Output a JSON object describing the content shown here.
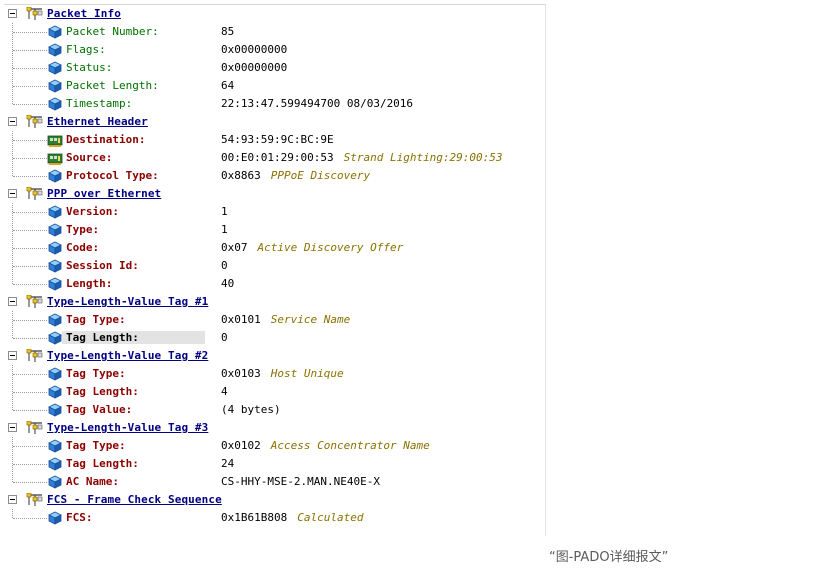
{
  "tree": {
    "sections": [
      {
        "title": "Packet Info",
        "fields": [
          {
            "name": "Packet Number:",
            "value": "85",
            "desc": "",
            "style": "plain",
            "icon": "cube-icon"
          },
          {
            "name": "Flags:",
            "value": "0x00000000",
            "desc": "",
            "style": "plain",
            "icon": "cube-icon"
          },
          {
            "name": "Status:",
            "value": "0x00000000",
            "desc": "",
            "style": "plain",
            "icon": "cube-icon"
          },
          {
            "name": "Packet Length:",
            "value": "64",
            "desc": "",
            "style": "plain",
            "icon": "cube-icon"
          },
          {
            "name": "Timestamp:",
            "value": "22:13:47.599494700 08/03/2016",
            "desc": "",
            "style": "plain",
            "icon": "cube-icon"
          }
        ]
      },
      {
        "title": "Ethernet Header",
        "fields": [
          {
            "name": "Destination:",
            "value": "54:93:59:9C:BC:9E",
            "desc": "",
            "style": "bold",
            "icon": "network-card-icon"
          },
          {
            "name": "Source:",
            "value": "00:E0:01:29:00:53",
            "desc": "Strand Lighting:29:00:53",
            "style": "bold",
            "icon": "network-card-icon"
          },
          {
            "name": "Protocol Type:",
            "value": "0x8863",
            "desc": "PPPoE Discovery",
            "style": "bold",
            "icon": "cube-icon"
          }
        ]
      },
      {
        "title": "PPP over Ethernet",
        "fields": [
          {
            "name": "Version:",
            "value": "1",
            "desc": "",
            "style": "bold",
            "icon": "cube-icon"
          },
          {
            "name": "Type:",
            "value": "1",
            "desc": "",
            "style": "bold",
            "icon": "cube-icon"
          },
          {
            "name": "Code:",
            "value": "0x07",
            "desc": "Active Discovery Offer",
            "style": "bold",
            "icon": "cube-icon"
          },
          {
            "name": "Session Id:",
            "value": "0",
            "desc": "",
            "style": "bold",
            "icon": "cube-icon"
          },
          {
            "name": "Length:",
            "value": "40",
            "desc": "",
            "style": "bold",
            "icon": "cube-icon"
          }
        ]
      },
      {
        "title": "Type-Length-Value Tag #1",
        "fields": [
          {
            "name": "Tag Type:",
            "value": "0x0101",
            "desc": "Service Name",
            "style": "bold",
            "icon": "cube-icon"
          },
          {
            "name": "Tag Length:",
            "value": "0",
            "desc": "",
            "style": "selected",
            "icon": "cube-icon"
          }
        ]
      },
      {
        "title": "Type-Length-Value Tag #2",
        "fields": [
          {
            "name": "Tag Type:",
            "value": "0x0103",
            "desc": "Host Unique",
            "style": "bold",
            "icon": "cube-icon"
          },
          {
            "name": "Tag Length:",
            "value": "4",
            "desc": "",
            "style": "bold",
            "icon": "cube-icon"
          },
          {
            "name": "Tag Value:",
            "value": "(4 bytes)",
            "desc": "",
            "style": "bold",
            "icon": "cube-icon"
          }
        ]
      },
      {
        "title": "Type-Length-Value Tag #3",
        "fields": [
          {
            "name": "Tag Type:",
            "value": "0x0102",
            "desc": "Access Concentrator Name",
            "style": "bold",
            "icon": "cube-icon"
          },
          {
            "name": "Tag Length:",
            "value": "24",
            "desc": "",
            "style": "bold",
            "icon": "cube-icon"
          },
          {
            "name": "AC Name:",
            "value": "CS-HHY-MSE-2.MAN.NE40E-X",
            "desc": "",
            "style": "bold",
            "icon": "cube-icon"
          }
        ]
      },
      {
        "title": "FCS - Frame Check Sequence",
        "fields": [
          {
            "name": "FCS:",
            "value": "0x1B61B808",
            "desc": "Calculated",
            "style": "bold",
            "icon": "cube-icon"
          }
        ]
      }
    ]
  },
  "caption": "“图-PADO详细报文”",
  "colors": {
    "header_title": "#000080",
    "field_plain": "#007000",
    "field_bold": "#8b0000",
    "description": "#8a7100",
    "selected_bg": "#e3e3e3"
  }
}
